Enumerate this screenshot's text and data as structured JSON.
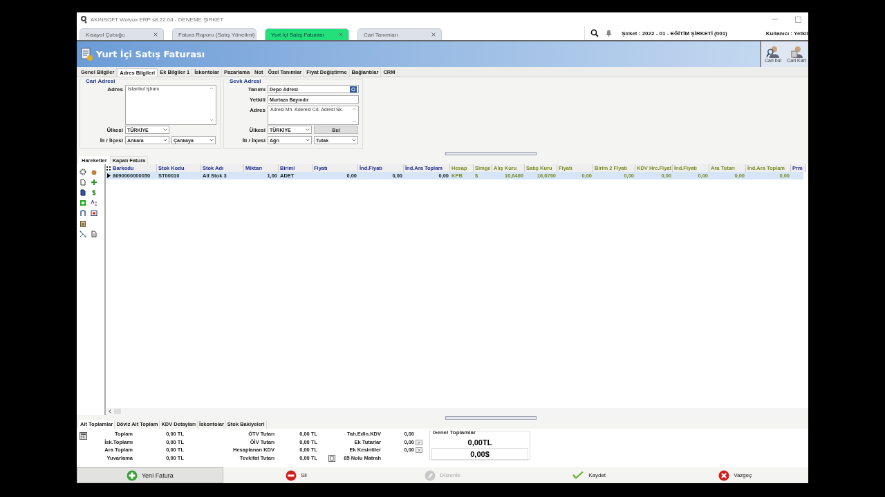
{
  "window": {
    "title": "AKINSOFT Wolvox ERP s8.22.04 - DENEME ŞİRKET"
  },
  "doc_tabs": [
    {
      "label": "Kısayol Çubuğu",
      "selected": false
    },
    {
      "label": "Fatura Raporu (Satış Yönetimi)",
      "selected": false
    },
    {
      "label": "Yurt İçi Satış Faturası",
      "selected": true
    },
    {
      "label": "Cari Tanımları",
      "selected": false
    }
  ],
  "company": "Şirket : 2022 - 01 - EĞİTİM ŞİRKETİ (001)",
  "user": "Kullanıcı : Yetkil",
  "header": {
    "title": "Yurt İçi Satış Faturası",
    "buttons": [
      "Cari bul",
      "Cari Kart"
    ]
  },
  "section_tabs": [
    {
      "label": "Genel Bilgiler",
      "selected": false
    },
    {
      "label": "Adres Bilgileri",
      "selected": true
    },
    {
      "label": "Ek Bilgiler 1",
      "selected": false
    },
    {
      "label": "İskontolar",
      "selected": false
    },
    {
      "label": "Pazarlama",
      "selected": false
    },
    {
      "label": "Not",
      "selected": false
    },
    {
      "label": "Özel Tanımlar",
      "selected": false
    },
    {
      "label": "Fiyat Değiştirme",
      "selected": false
    },
    {
      "label": "Bağlantılar",
      "selected": false
    },
    {
      "label": "CRM",
      "selected": false
    }
  ],
  "cari_adresi": {
    "title": "Cari Adresi",
    "address_label": "Adres",
    "address": "İstanbul işhanı",
    "country_label": "Ülkesi",
    "country": "TÜRKİYE",
    "city_label": "İli / İlçesi",
    "city": "Ankara",
    "district": "Çankaya"
  },
  "sevk_adresi": {
    "title": "Sevk Adresi",
    "name_label": "Tanımı",
    "name": "Depo Adresi",
    "contact_label": "Yetkili",
    "contact": "Murtaza Bayındır",
    "address_label": "Adres",
    "address": "Adresi Mh. Aderesi Cd. Adresi Sk.",
    "country_label": "Ülkesi",
    "country": "TÜRKİYE",
    "find_button": "Bul",
    "city_label": "İli / İlçesi",
    "city": "Ağrı",
    "district": "Tutak"
  },
  "grid_tabs": [
    {
      "label": "Hareketler",
      "selected": true
    },
    {
      "label": "Kapalı Fatura",
      "selected": false
    }
  ],
  "table": {
    "columns": [
      {
        "label": "Barkodu",
        "kind": "main"
      },
      {
        "label": "Stok Kodu",
        "kind": "main"
      },
      {
        "label": "Stok Adı",
        "kind": "main"
      },
      {
        "label": "Miktarı",
        "kind": "main"
      },
      {
        "label": "Birimi",
        "kind": "main"
      },
      {
        "label": "Fiyatı",
        "kind": "main"
      },
      {
        "label": "İnd.Fiyatı",
        "kind": "main"
      },
      {
        "label": "İnd.Ara Toplam",
        "kind": "main"
      },
      {
        "label": "Hesap",
        "kind": "currency"
      },
      {
        "label": "Simge",
        "kind": "currency"
      },
      {
        "label": "Alış Kuru",
        "kind": "currency"
      },
      {
        "label": "Satış Kuru",
        "kind": "currency"
      },
      {
        "label": "Fiyatı",
        "kind": "currency"
      },
      {
        "label": "Birim 2 Fiyatı",
        "kind": "currency"
      },
      {
        "label": "KDV Hrc.Fiyat",
        "kind": "currency"
      },
      {
        "label": "İnd.Fiyatı",
        "kind": "currency"
      },
      {
        "label": "Ara Tutarı",
        "kind": "currency"
      },
      {
        "label": "İnd.Ara Toplam",
        "kind": "currency"
      },
      {
        "label": "Prm",
        "kind": "main"
      }
    ],
    "rows": [
      {
        "selected": true,
        "cells": [
          "8690000000050",
          "ST00010",
          "Alt Stok 3",
          "1,00",
          "ADET",
          "0,00",
          "0,00",
          "0,00",
          "KPB",
          "$",
          "16,6460",
          "16,6760",
          "0,00",
          "0,00",
          "0,00",
          "0,00",
          "0,00",
          "0,00"
        ]
      }
    ]
  },
  "bottom_tabs": [
    {
      "label": "Alt Toplamlar",
      "selected": true
    },
    {
      "label": "Döviz Alt Toplam",
      "selected": false
    },
    {
      "label": "KDV Detayları",
      "selected": false
    },
    {
      "label": "İskontolar",
      "selected": false
    },
    {
      "label": "Stok Bakiyeleri",
      "selected": false
    }
  ],
  "totals_left": [
    {
      "label": "Toplam",
      "value": "0,00 TL"
    },
    {
      "label": "İsk.Toplamı",
      "value": "0,00 TL"
    },
    {
      "label": "Ara Toplam",
      "value": "0,00 TL"
    },
    {
      "label": "Yuvarlama",
      "value": "0,00 TL"
    }
  ],
  "totals_mid": [
    {
      "label": "ÖTV Tutarı",
      "value": "0,00 TL"
    },
    {
      "label": "ÖİV Tutarı",
      "value": "0,00 TL"
    },
    {
      "label": "Hesaplanan KDV",
      "value": "0,00 TL"
    },
    {
      "label": "Tevkifat Tutarı",
      "value": "0,00 TL"
    }
  ],
  "totals_right": [
    {
      "label": "Tah.Edln.KDV",
      "value": "0,00",
      "kind": "plain"
    },
    {
      "label": "Ek Tutarlar",
      "value": "0,00",
      "kind": "more"
    },
    {
      "label": "Ek Kesintiler",
      "value": "0,00",
      "kind": "more"
    },
    {
      "label": "85 Nolu Matrah",
      "kind": "doc"
    }
  ],
  "more_button": ">",
  "grand_totals": {
    "title": "Genel Toplamlar",
    "tl": "0,00TL",
    "usd": "0,00$"
  },
  "actions": [
    {
      "label": "Yeni Fatura",
      "kind": "new",
      "disabled": false,
      "selected": true
    },
    {
      "label": "Sil",
      "kind": "delete",
      "disabled": false,
      "selected": false
    },
    {
      "label": "Düzenle",
      "kind": "edit",
      "disabled": true,
      "selected": false
    },
    {
      "label": "Kaydet",
      "kind": "save",
      "disabled": false,
      "selected": false
    },
    {
      "label": "Vazgeç",
      "kind": "cancel",
      "disabled": false,
      "selected": false
    }
  ]
}
